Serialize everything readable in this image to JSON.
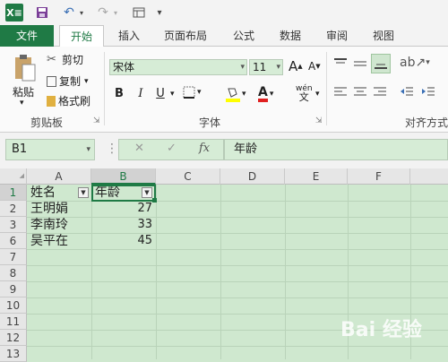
{
  "quick_access": {
    "logo": "X≡",
    "save_icon": "save-icon",
    "undo_glyph": "↶",
    "redo_glyph": "↷"
  },
  "tabs": [
    "文件",
    "开始",
    "插入",
    "页面布局",
    "公式",
    "数据",
    "审阅",
    "视图"
  ],
  "clipboard": {
    "paste": "粘贴",
    "cut": "剪切",
    "copy": "复制",
    "format_painter": "格式刷",
    "group_label": "剪贴板"
  },
  "font": {
    "name": "宋体",
    "size": "11",
    "group_label": "字体",
    "bold": "B",
    "italic": "I",
    "underline": "U",
    "grow": "A",
    "shrink": "A",
    "phonetic": "wén",
    "phonetic_sub": "文"
  },
  "alignment": {
    "group_label": "对齐方式"
  },
  "formula_bar": {
    "name_box": "B1",
    "fx": "fx",
    "content": "年龄",
    "cancel": "✕",
    "enter": "✓"
  },
  "columns": [
    "A",
    "B",
    "C",
    "D",
    "E",
    "F"
  ],
  "rows": [
    "1",
    "2",
    "3",
    "6",
    "7",
    "8",
    "9",
    "10",
    "11",
    "12",
    "13"
  ],
  "cells": {
    "a1": "姓名",
    "b1": "年龄",
    "a2": "王明娟",
    "b2": "27",
    "a3": "李南玲",
    "b3": "33",
    "a6": "吴平在",
    "b6": "45"
  },
  "watermark": "Bai 经验"
}
